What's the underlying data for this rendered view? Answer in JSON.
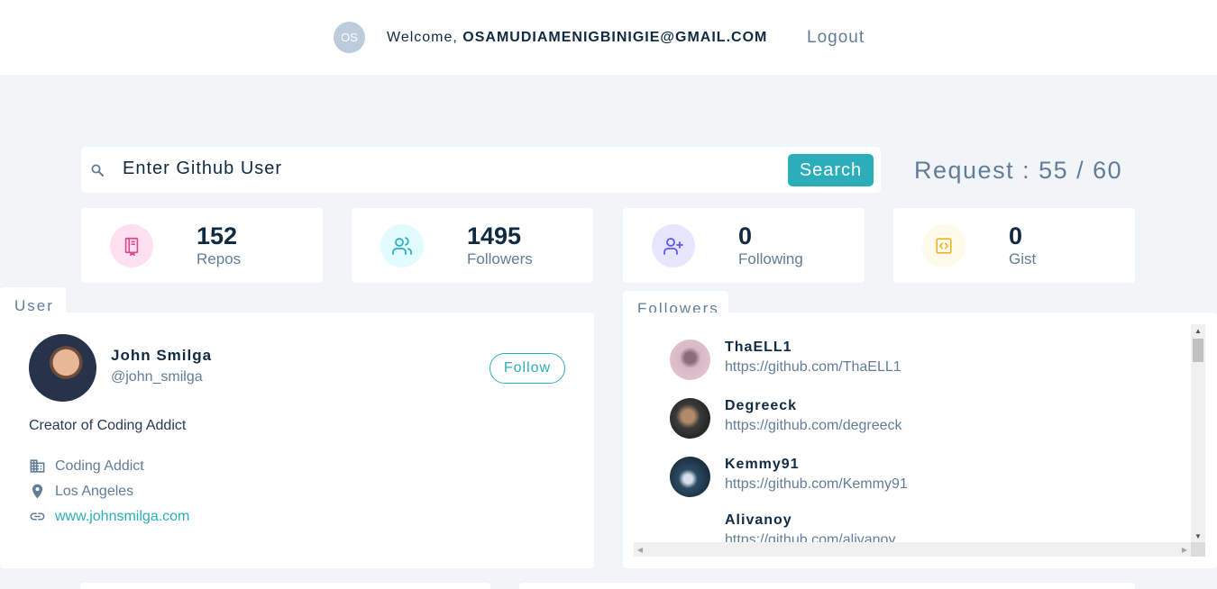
{
  "navbar": {
    "avatar_initials": "OS",
    "welcome_prefix": "Welcome,",
    "user_email": "osamudiamenigbinigie@gmail.com",
    "logout_label": "Logout"
  },
  "search": {
    "placeholder": "Enter Github User",
    "button_label": "Search",
    "request_text": "Request : 55 / 60"
  },
  "stats": [
    {
      "value": "152",
      "label": "Repos",
      "icon": "book-icon",
      "color": "#da4a91",
      "bg": "#ffe0f0"
    },
    {
      "value": "1495",
      "label": "Followers",
      "icon": "users-icon",
      "color": "#2caeba",
      "bg": "#e0fcff"
    },
    {
      "value": "0",
      "label": "Following",
      "icon": "user-plus-icon",
      "color": "#5d55fa",
      "bg": "#e6e6ff"
    },
    {
      "value": "0",
      "label": "Gist",
      "icon": "code-icon",
      "color": "#f0b429",
      "bg": "#fffbea"
    }
  ],
  "user": {
    "tab_label": "User",
    "name": "John Smilga",
    "handle": "@john_smilga",
    "follow_label": "Follow",
    "bio": "Creator of Coding Addict",
    "company": "Coding Addict",
    "location": "Los Angeles",
    "blog": "www.johnsmilga.com"
  },
  "followers": {
    "tab_label": "Followers",
    "items": [
      {
        "name": "ThaELL1",
        "url": "https://github.com/ThaELL1"
      },
      {
        "name": "Degreeck",
        "url": "https://github.com/degreeck"
      },
      {
        "name": "Kemmy91",
        "url": "https://github.com/Kemmy91"
      },
      {
        "name": "Alivanoy",
        "url": "https://github.com/alivanoy"
      }
    ]
  },
  "colors": {
    "primary": "#2caeba",
    "text": "#102a42",
    "muted": "#617d98",
    "background": "#f1f5f8"
  }
}
